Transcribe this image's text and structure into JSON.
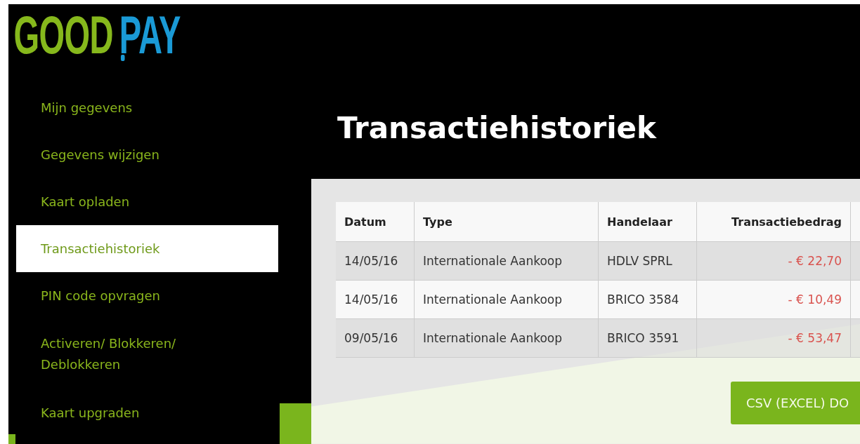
{
  "logo": {
    "part_1": "GOOD",
    "part_2": "PAY"
  },
  "sidebar": {
    "items": [
      {
        "label": "Mijn gegevens",
        "selected": false
      },
      {
        "label": "Gegevens wijzigen",
        "selected": false
      },
      {
        "label": "Kaart opladen",
        "selected": false
      },
      {
        "label": "Transactiehistoriek",
        "selected": true
      },
      {
        "label": "PIN code opvragen",
        "selected": false
      },
      {
        "label": "Activeren/ Blokkeren/ Deblokkeren",
        "selected": false
      },
      {
        "label": "Kaart upgraden",
        "selected": false
      }
    ]
  },
  "page_title": "Transactiehistoriek",
  "table": {
    "columns": [
      "Datum",
      "Type",
      "Handelaar",
      "Transactiebedrag"
    ],
    "rows": [
      [
        "14/05/16",
        "Internationale Aankoop",
        "HDLV SPRL",
        "- € 22,70"
      ],
      [
        "14/05/16",
        "Internationale Aankoop",
        "BRICO 3584",
        "- € 10,49"
      ],
      [
        "09/05/16",
        "Internationale Aankoop",
        "BRICO 3591",
        "- € 53,47"
      ]
    ]
  },
  "download_button": "CSV (EXCEL) DO"
}
